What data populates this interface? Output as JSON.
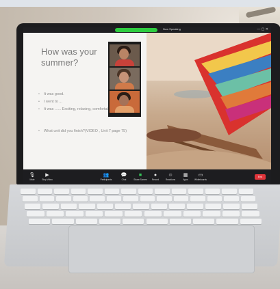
{
  "slide": {
    "title": "How was your summer?",
    "bullets": [
      "It was good.",
      "I went to ...",
      "It was ...... Exciting, relaxing, comfortable, ...",
      "What unit did you finish?(VIDEO , Unit 7 page 75)"
    ]
  },
  "zoom": {
    "top_bar": {
      "speaker_label": "Now Speaking",
      "window_controls": "— ▢ ✕"
    },
    "toolbar": [
      {
        "label": "Mute",
        "icon": "mic-icon"
      },
      {
        "label": "Stop Video",
        "icon": "video-icon"
      },
      {
        "label": "Participants",
        "icon": "participants-icon"
      },
      {
        "label": "Chat",
        "icon": "chat-icon"
      },
      {
        "label": "Share Screen",
        "icon": "share-screen-icon"
      },
      {
        "label": "Record",
        "icon": "record-icon"
      },
      {
        "label": "Reactions",
        "icon": "reactions-icon"
      },
      {
        "label": "Apps",
        "icon": "apps-icon"
      },
      {
        "label": "Whiteboards",
        "icon": "whiteboard-icon"
      }
    ],
    "end_label": "End",
    "colors": {
      "share_green": "#35c759",
      "end_red": "#e0343a",
      "toolbar_bg": "#1d1d20"
    }
  }
}
